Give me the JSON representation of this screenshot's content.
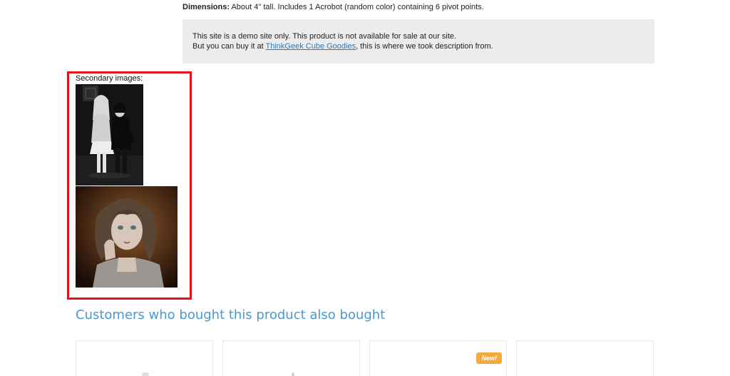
{
  "product": {
    "dimensions_label": "Dimensions:",
    "dimensions_text": " About 4\" tall. Includes 1 Acrobot (random color) containing 6 pivot points."
  },
  "notice": {
    "line1": "This site is a demo site only. This product is not available for sale at our site.",
    "line2_prefix": "But you can buy it at ",
    "link_text": "ThinkGeek Cube Goodies",
    "line2_suffix": ", this is where we took description from."
  },
  "secondary_images": {
    "label": "Secondary images:",
    "images": [
      {
        "alt": "doll-pair-photo"
      },
      {
        "alt": "doll-portrait-photo"
      }
    ]
  },
  "related": {
    "title": "Customers who bought this product also bought",
    "cards": [
      {
        "badge": ""
      },
      {
        "badge": ""
      },
      {
        "badge": "New!"
      },
      {
        "badge": ""
      }
    ]
  },
  "colors": {
    "highlight": "#e3121a",
    "link": "#2a7ab8",
    "section_title": "#4a98cf",
    "badge": "#f5ab3c"
  }
}
